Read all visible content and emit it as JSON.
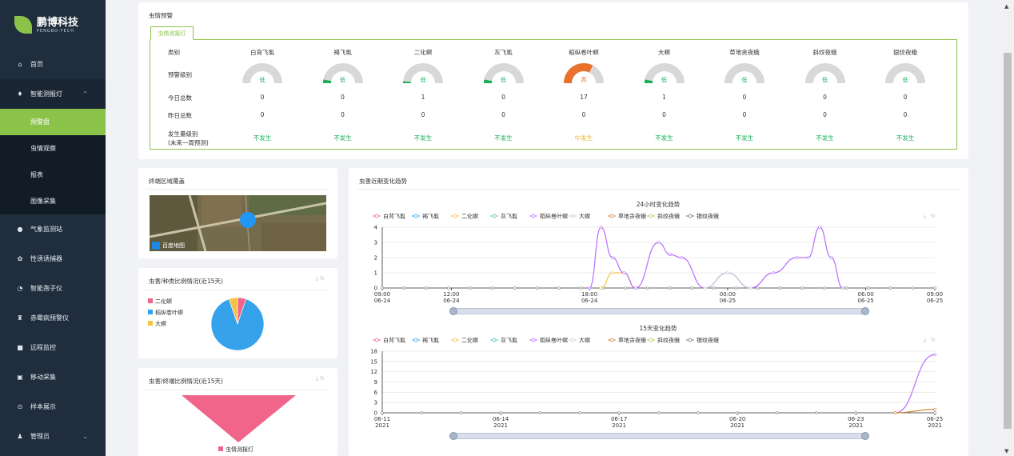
{
  "brand": {
    "name": "鹏博科技",
    "sub": "PENGBO-TECH"
  },
  "nav": [
    {
      "label": "首页",
      "icon": "home-icon",
      "glyph": "⌂"
    },
    {
      "label": "智能测报灯",
      "icon": "bulb-icon",
      "glyph": "♦",
      "open": true
    },
    {
      "label": "气象监测站",
      "icon": "drop-icon",
      "glyph": "●"
    },
    {
      "label": "性诱诱捕器",
      "icon": "trap-icon",
      "glyph": "✿"
    },
    {
      "label": "智能孢子仪",
      "icon": "gauge-icon",
      "glyph": "◔"
    },
    {
      "label": "赤霉病预警仪",
      "icon": "alarm-icon",
      "glyph": "♜"
    },
    {
      "label": "远程监控",
      "icon": "camera-icon",
      "glyph": "■"
    },
    {
      "label": "移动采集",
      "icon": "box-icon",
      "glyph": "▣"
    },
    {
      "label": "样本展示",
      "icon": "sample-icon",
      "glyph": "⊙"
    },
    {
      "label": "管理员",
      "icon": "user-icon",
      "glyph": "♟"
    }
  ],
  "subnav": [
    {
      "label": "预警盘",
      "active": true
    },
    {
      "label": "虫情观察"
    },
    {
      "label": "报表"
    },
    {
      "label": "图像采集"
    }
  ],
  "warning": {
    "title": "虫情预警",
    "tab": "虫情测报灯",
    "row_labels": {
      "category": "类别",
      "level": "预警级别",
      "today": "今日总数",
      "yesterday": "昨日总数",
      "occur1": "发生量级别",
      "occur2": "(未来一周预测)"
    },
    "columns": [
      {
        "name": "白背飞虱",
        "level": "低",
        "fill": 0.0,
        "color": "#1aad5a",
        "today": "0",
        "yesterday": "0",
        "occur": "不发生",
        "occur_color": "#1aad5a"
      },
      {
        "name": "褐飞虱",
        "level": "低",
        "fill": 0.06,
        "color": "#1aad5a",
        "today": "0",
        "yesterday": "0",
        "occur": "不发生",
        "occur_color": "#1aad5a"
      },
      {
        "name": "二化螟",
        "level": "低",
        "fill": 0.03,
        "color": "#1aad5a",
        "today": "1",
        "yesterday": "0",
        "occur": "不发生",
        "occur_color": "#1aad5a"
      },
      {
        "name": "灰飞虱",
        "level": "低",
        "fill": 0.06,
        "color": "#1aad5a",
        "today": "0",
        "yesterday": "0",
        "occur": "不发生",
        "occur_color": "#1aad5a"
      },
      {
        "name": "稻纵卷叶螟",
        "level": "高",
        "fill": 0.65,
        "color": "#e8722c",
        "today": "17",
        "yesterday": "0",
        "occur": "中发生",
        "occur_color": "#f0b619"
      },
      {
        "name": "大螟",
        "level": "低",
        "fill": 0.06,
        "color": "#1aad5a",
        "today": "1",
        "yesterday": "0",
        "occur": "不发生",
        "occur_color": "#1aad5a"
      },
      {
        "name": "草地贪夜蛾",
        "level": "低",
        "fill": 0.0,
        "color": "#1aad5a",
        "today": "0",
        "yesterday": "0",
        "occur": "不发生",
        "occur_color": "#1aad5a"
      },
      {
        "name": "斜纹夜蛾",
        "level": "低",
        "fill": 0.0,
        "color": "#1aad5a",
        "today": "0",
        "yesterday": "0",
        "occur": "不发生",
        "occur_color": "#1aad5a"
      },
      {
        "name": "银纹夜蛾",
        "level": "低",
        "fill": 0.0,
        "color": "#1aad5a",
        "today": "0",
        "yesterday": "0",
        "occur": "不发生",
        "occur_color": "#1aad5a"
      }
    ]
  },
  "area": {
    "title": "终端区域覆盖",
    "map_label": "百度地图"
  },
  "pie": {
    "title": "虫害/种类比例情况(近15天)"
  },
  "funnel": {
    "title": "虫害/终端比例情况(近15天)",
    "legend": "虫情测报灯",
    "color": "#f06589"
  },
  "trend": {
    "title": "虫害近期变化趋势"
  },
  "chart_data": [
    {
      "type": "pie",
      "title": "虫害/种类比例情况(近15天)",
      "slices": [
        {
          "name": "二化螟",
          "value": 1,
          "color": "#f06589"
        },
        {
          "name": "稻纵卷叶螟",
          "value": 17,
          "color": "#36a2eb"
        },
        {
          "name": "大螟",
          "value": 1,
          "color": "#f7c244"
        }
      ]
    },
    {
      "type": "line",
      "title": "24小时变化趋势",
      "x": [
        "09:00\n06-24",
        "12:00\n06-24",
        "18:00\n06-24",
        "00:00\n06-25",
        "06:00\n06-25",
        "09:00\n06-25"
      ],
      "ylim": [
        0,
        4
      ],
      "yticks": [
        0,
        1,
        2,
        3,
        4
      ],
      "series": [
        {
          "name": "白背飞虱",
          "color": "#f06589",
          "values": []
        },
        {
          "name": "褐飞虱",
          "color": "#36a2eb",
          "values": []
        },
        {
          "name": "二化螟",
          "color": "#f7c244",
          "values": [
            [
              18.5,
              0
            ],
            [
              19,
              1
            ],
            [
              19.5,
              1
            ],
            [
              20,
              0
            ]
          ]
        },
        {
          "name": "灰飞虱",
          "color": "#4bc0c0",
          "values": []
        },
        {
          "name": "稻纵卷叶螟",
          "color": "#b86bff",
          "values": [
            [
              18,
              0
            ],
            [
              18.5,
              4
            ],
            [
              19,
              2
            ],
            [
              19.5,
              1
            ],
            [
              20,
              0
            ],
            [
              21,
              3
            ],
            [
              21.5,
              2.2
            ],
            [
              22,
              2
            ],
            [
              23,
              0
            ],
            [
              24,
              1
            ],
            [
              25,
              0
            ],
            [
              26,
              1
            ],
            [
              27,
              2
            ],
            [
              27.5,
              2
            ],
            [
              28,
              4
            ],
            [
              28.5,
              2
            ],
            [
              29,
              0
            ]
          ]
        },
        {
          "name": "大螟",
          "color": "#c9cbcf",
          "values": [
            [
              23,
              0
            ],
            [
              24,
              1
            ],
            [
              25,
              0
            ]
          ]
        },
        {
          "name": "草地贪夜蛾",
          "color": "#cc8a3a",
          "values": []
        },
        {
          "name": "斜纹夜蛾",
          "color": "#b5c24a",
          "values": []
        },
        {
          "name": "银纹夜蛾",
          "color": "#777777",
          "values": []
        }
      ]
    },
    {
      "type": "line",
      "title": "15天变化趋势",
      "x": [
        "06-11\n2021",
        "06-14\n2021",
        "06-17\n2021",
        "06-20\n2021",
        "06-23\n2021",
        "06-25\n2021"
      ],
      "ylim": [
        0,
        18
      ],
      "yticks": [
        0,
        3,
        6,
        9,
        12,
        15,
        18
      ],
      "series": [
        {
          "name": "稻纵卷叶螟",
          "color": "#b86bff",
          "values": [
            [
              13,
              0
            ],
            [
              14,
              17
            ]
          ]
        },
        {
          "name": "草地贪夜蛾",
          "color": "#cc8a3a",
          "values": [
            [
              13,
              0
            ],
            [
              14,
              1
            ]
          ]
        }
      ]
    }
  ]
}
